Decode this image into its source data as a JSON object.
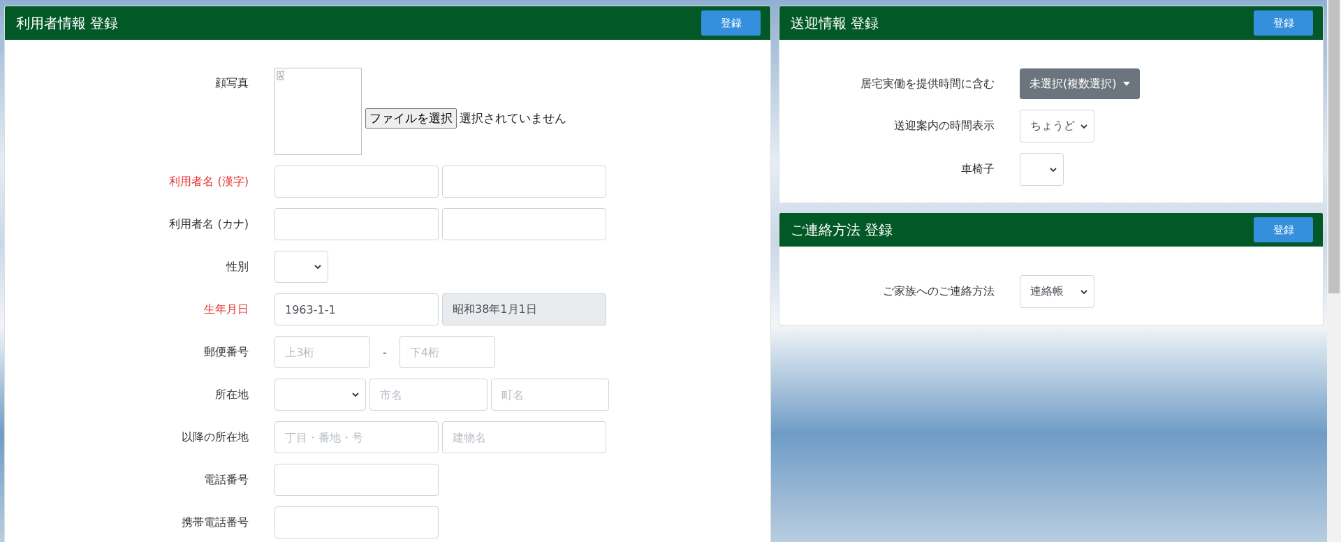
{
  "user_panel": {
    "title": "利用者情報 登録",
    "button": "登録",
    "fields": [
      {
        "label": "顔写真",
        "required": false,
        "controls": [
          {
            "kind": "photo"
          },
          {
            "kind": "file",
            "button": "ファイルを選択",
            "status": "選択されていません"
          }
        ]
      },
      {
        "label": "利用者名 (漢字)",
        "required": true,
        "controls": [
          {
            "kind": "text"
          },
          {
            "kind": "text"
          }
        ]
      },
      {
        "label": "利用者名 (カナ)",
        "required": false,
        "controls": [
          {
            "kind": "text"
          },
          {
            "kind": "text"
          }
        ]
      },
      {
        "label": "性別",
        "required": false,
        "controls": [
          {
            "kind": "select"
          }
        ]
      },
      {
        "label": "生年月日",
        "required": true,
        "controls": [
          {
            "kind": "text",
            "value": "1963-1-1"
          },
          {
            "kind": "readonly",
            "value": "昭和38年1月1日"
          }
        ]
      },
      {
        "label": "郵便番号",
        "required": false,
        "controls": [
          {
            "kind": "text",
            "placeholder": "上3桁"
          },
          {
            "kind": "separator",
            "text": "-"
          },
          {
            "kind": "text",
            "placeholder": "下4桁"
          }
        ]
      },
      {
        "label": "所在地",
        "required": false,
        "controls": [
          {
            "kind": "select"
          },
          {
            "kind": "text",
            "placeholder": "市名"
          },
          {
            "kind": "text",
            "placeholder": "町名"
          }
        ]
      },
      {
        "label": "以降の所在地",
        "required": false,
        "controls": [
          {
            "kind": "text",
            "placeholder": "丁目・番地・号"
          },
          {
            "kind": "text",
            "placeholder": "建物名"
          }
        ]
      },
      {
        "label": "電話番号",
        "required": false,
        "controls": [
          {
            "kind": "text"
          }
        ]
      },
      {
        "label": "携帯電話番号",
        "required": false,
        "controls": [
          {
            "kind": "text"
          }
        ]
      }
    ]
  },
  "side_panels": [
    {
      "title": "送迎情報 登録",
      "button": "登録",
      "fields": [
        {
          "label": "居宅実働を提供時間に含む",
          "required": false,
          "controls": [
            {
              "kind": "dropdown",
              "value": "未選択(複数選択)"
            }
          ]
        },
        {
          "label": "送迎案内の時間表示",
          "required": false,
          "controls": [
            {
              "kind": "select",
              "value": "ちょうど"
            }
          ]
        },
        {
          "label": "車椅子",
          "required": false,
          "controls": [
            {
              "kind": "select"
            }
          ]
        }
      ]
    },
    {
      "title": "ご連絡方法 登録",
      "button": "登録",
      "fields": [
        {
          "label": "ご家族へのご連絡方法",
          "required": false,
          "controls": [
            {
              "kind": "select",
              "value": "連絡帳"
            }
          ]
        }
      ]
    }
  ]
}
